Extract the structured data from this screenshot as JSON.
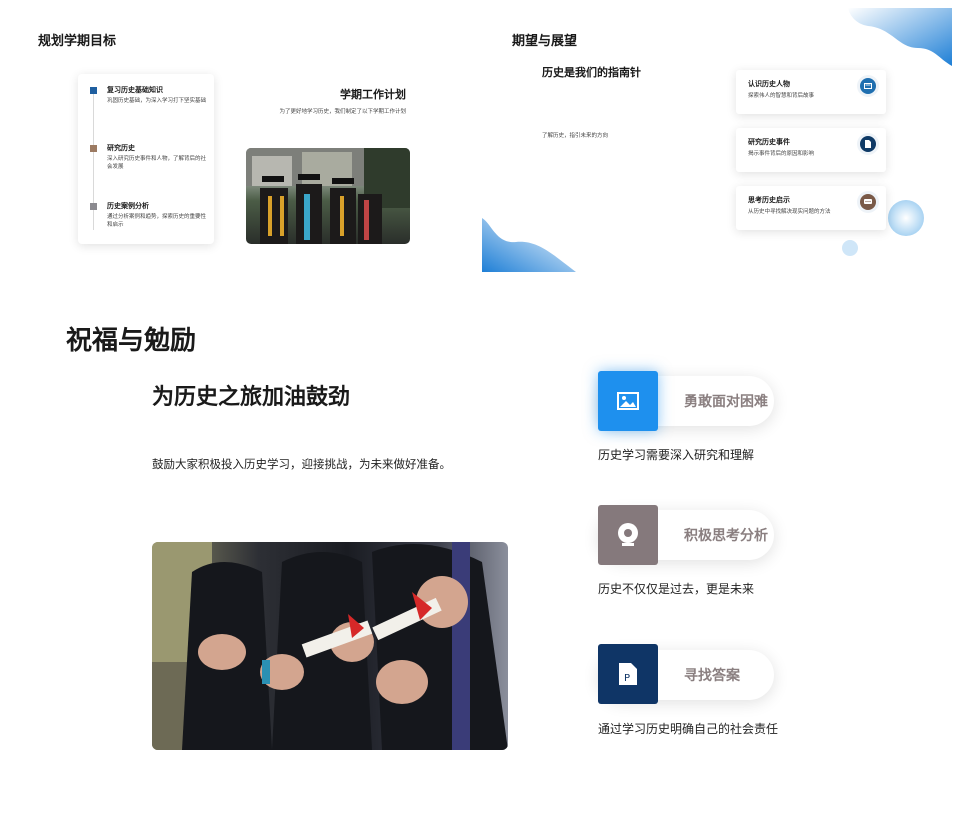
{
  "slide1": {
    "title": "规划学期目标",
    "timeline": [
      {
        "name": "复习历史基础知识",
        "desc": "巩固历史基础，为深入学习打下坚实基础",
        "color": "#1f5fa0"
      },
      {
        "name": "研究历史",
        "desc": "深入研究历史事件和人物，了解背后的社会发展",
        "color": "#9c7a62"
      },
      {
        "name": "历史案例分析",
        "desc": "通过分析案例和趋势，探索历史的重要性和启示",
        "color": "#8b8a8f"
      }
    ],
    "plan_title": "学期工作计划",
    "plan_desc": "为了更好地学习历史，我们制定了以下学期工作计划"
  },
  "slide2": {
    "title": "期望与展望",
    "subtitle": "历史是我们的指南针",
    "subdesc": "了解历史，指引未来的方向",
    "cards": [
      {
        "name": "认识历史人物",
        "desc": "探索伟人的智慧和背后故事",
        "icon": "card-icon",
        "color": "#1f6fb0"
      },
      {
        "name": "研究历史事件",
        "desc": "揭示事件背后的原因和影响",
        "icon": "document-icon",
        "color": "#0f3a66"
      },
      {
        "name": "思考历史启示",
        "desc": "从历史中寻找解决现实问题的方法",
        "icon": "chat-icon",
        "color": "#7a5a48"
      }
    ]
  },
  "slide3": {
    "title": "祝福与勉励",
    "heading": "为历史之旅加油鼓劲",
    "body": "鼓励大家积极投入历史学习，迎接挑战，为未来做好准备。",
    "items": [
      {
        "label": "勇敢面对困难",
        "desc": "历史学习需要深入研究和理解",
        "icon": "image-icon",
        "color": "#1e90ee"
      },
      {
        "label": "积极思考分析",
        "desc": "历史不仅仅是过去，更是未来",
        "icon": "webcam-icon",
        "color": "#85797c"
      },
      {
        "label": "寻找答案",
        "desc": "通过学习历史明确自己的社会责任",
        "icon": "ppt-file-icon",
        "color": "#0f3566"
      }
    ]
  }
}
